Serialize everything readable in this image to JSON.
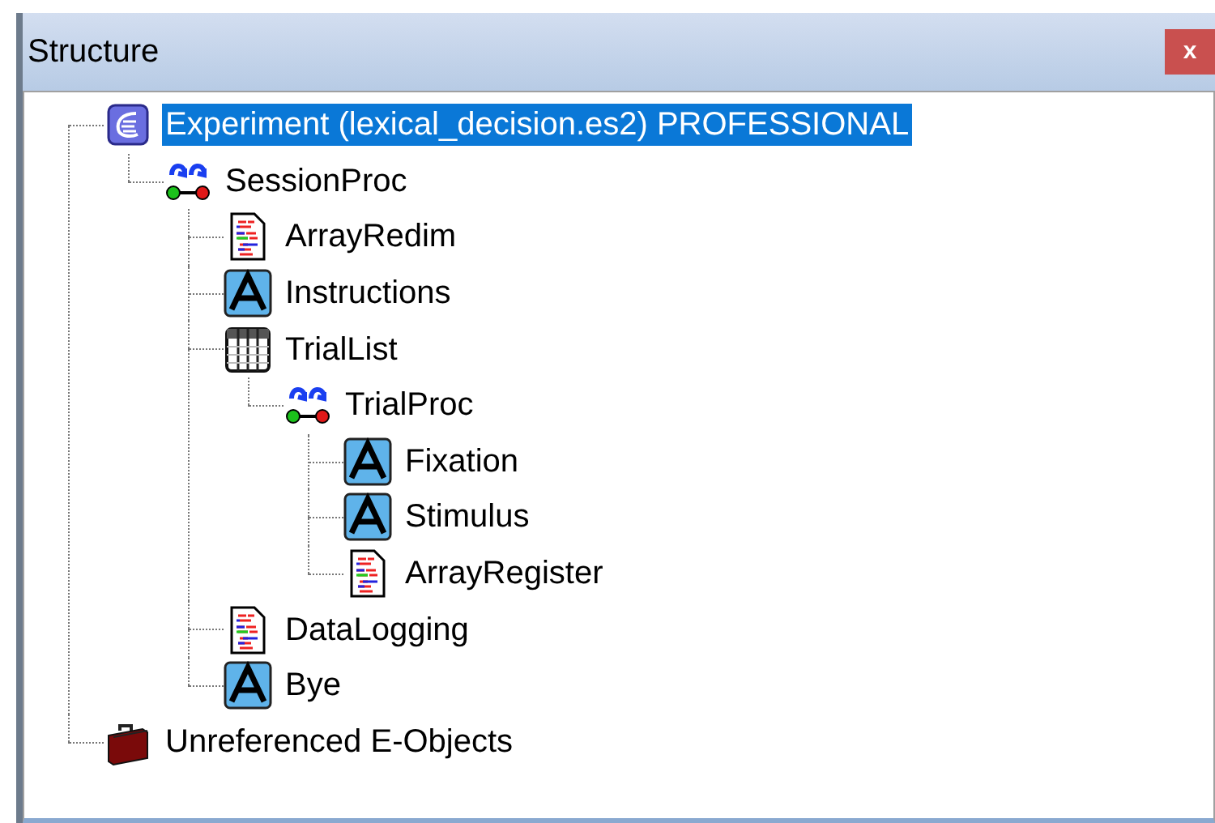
{
  "window": {
    "title": "Structure",
    "close": "x"
  },
  "tree": [
    {
      "label": "Experiment (lexical_decision.es2) PROFESSIONAL",
      "kind": "experiment",
      "selected": true,
      "children": [
        {
          "label": "SessionProc",
          "kind": "procedure",
          "selected": false,
          "children": [
            {
              "label": "ArrayRedim",
              "kind": "script",
              "selected": false
            },
            {
              "label": "Instructions",
              "kind": "text",
              "selected": false
            },
            {
              "label": "TrialList",
              "kind": "list",
              "selected": false,
              "children": [
                {
                  "label": "TrialProc",
                  "kind": "procedure",
                  "selected": false,
                  "children": [
                    {
                      "label": "Fixation",
                      "kind": "text",
                      "selected": false
                    },
                    {
                      "label": "Stimulus",
                      "kind": "text",
                      "selected": false
                    },
                    {
                      "label": "ArrayRegister",
                      "kind": "script",
                      "selected": false
                    }
                  ]
                }
              ]
            },
            {
              "label": "DataLogging",
              "kind": "script",
              "selected": false
            },
            {
              "label": "Bye",
              "kind": "text",
              "selected": false
            }
          ]
        }
      ]
    },
    {
      "label": "Unreferenced E-Objects",
      "kind": "case",
      "selected": false
    }
  ]
}
